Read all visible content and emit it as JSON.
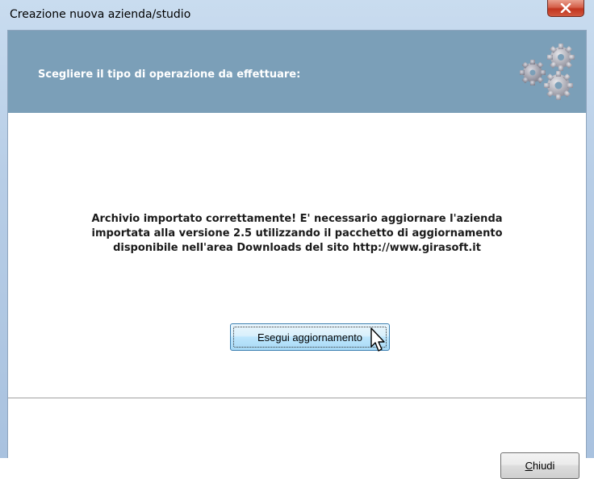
{
  "window": {
    "title": "Creazione nuova azienda/studio",
    "close_icon": "close-x-icon"
  },
  "header": {
    "instruction": "Scegliere il tipo di operazione da effettuare:",
    "logo_icon": "gears-icon"
  },
  "main": {
    "message": "Archivio importato correttamente! E' necessario aggiornare l'azienda\nimportata alla versione 2.5 utilizzando il pacchetto di aggiornamento\ndisponibile nell'area Downloads del sito http://www.girasoft.it",
    "update_button_label": "Esegui aggiornamento"
  },
  "footer": {
    "close_button_mnemonic": "C",
    "close_button_rest": "hiudi"
  },
  "colors": {
    "header_band": "#7b9fb8",
    "header_text": "#ffffff",
    "close_button": "#c2351f"
  }
}
